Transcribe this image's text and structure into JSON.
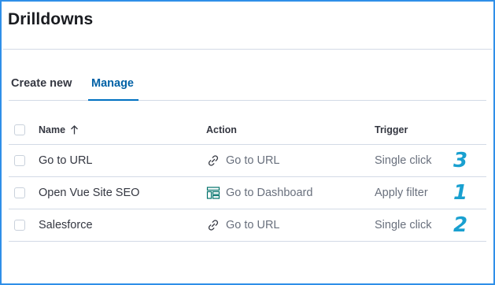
{
  "page": {
    "title": "Drilldowns"
  },
  "tabs": [
    {
      "label": "Create new",
      "active": false
    },
    {
      "label": "Manage",
      "active": true
    }
  ],
  "table": {
    "columns": {
      "name": "Name",
      "action": "Action",
      "trigger": "Trigger"
    },
    "sort": {
      "column": "Name",
      "direction": "ascending",
      "icon": "arrow-up-icon"
    },
    "rows": [
      {
        "name": "Go to URL",
        "action": "Go to URL",
        "action_icon": "link-icon",
        "trigger": "Single click",
        "annotation": "3"
      },
      {
        "name": "Open Vue Site SEO",
        "action": "Go to Dashboard",
        "action_icon": "dashboard-icon",
        "trigger": "Apply filter",
        "annotation": "1"
      },
      {
        "name": "Salesforce",
        "action": "Go to URL",
        "action_icon": "link-icon",
        "trigger": "Single click",
        "annotation": "2"
      }
    ]
  },
  "colors": {
    "frame_border": "#2f8fe8",
    "active_tab": "#0061a6",
    "annotation": "#19a0d0",
    "dashboard_icon": "#00726b"
  }
}
